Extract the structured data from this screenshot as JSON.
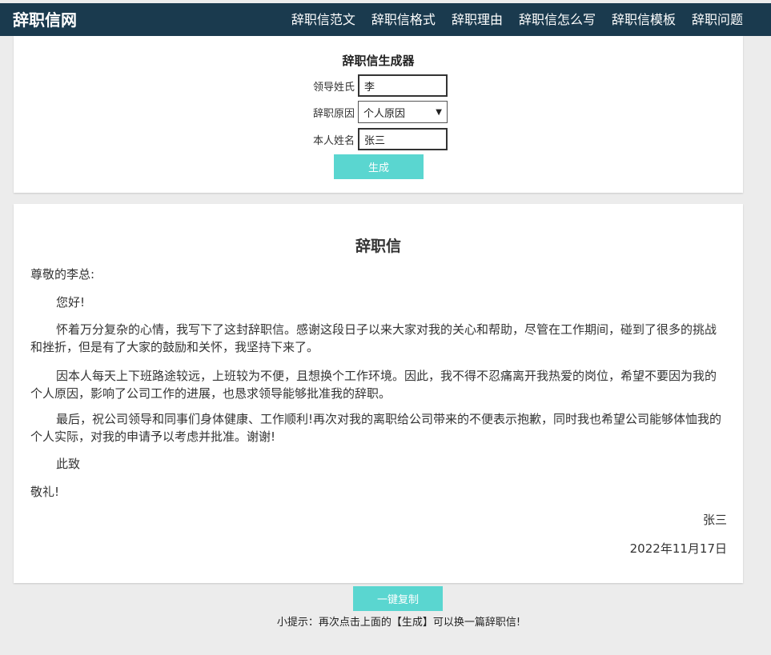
{
  "header": {
    "logo": "辞职信网",
    "nav": [
      "辞职信范文",
      "辞职信格式",
      "辞职理由",
      "辞职信怎么写",
      "辞职信模板",
      "辞职问题"
    ]
  },
  "generator": {
    "title": "辞职信生成器",
    "leader_label": "领导姓氏",
    "leader_value": "李",
    "reason_label": "辞职原因",
    "reason_value": "个人原因",
    "name_label": "本人姓名",
    "name_value": "张三",
    "generate_label": "生成"
  },
  "letter": {
    "title": "辞职信",
    "greeting": "尊敬的李总:",
    "hello": "您好!",
    "para1": "怀着万分复杂的心情，我写下了这封辞职信。感谢这段日子以来大家对我的关心和帮助，尽管在工作期间，碰到了很多的挑战和挫折，但是有了大家的鼓励和关怀，我坚持下来了。",
    "para2": "因本人每天上下班路途较远，上班较为不便，且想换个工作环境。因此，我不得不忍痛离开我热爱的岗位，希望不要因为我的个人原因，影响了公司工作的进展，也恳求领导能够批准我的辞职。",
    "para3": "最后，祝公司领导和同事们身体健康、工作顺利!再次对我的离职给公司带来的不便表示抱歉，同时我也希望公司能够体恤我的个人实际，对我的申请予以考虑并批准。谢谢!",
    "closing": "此致",
    "regards": "敬礼!",
    "signature": "张三",
    "date": "2022年11月17日"
  },
  "footer": {
    "copy_label": "一键复制",
    "tip": "小提示：再次点击上面的【生成】可以换一篇辞职信!"
  },
  "colors": {
    "header_bg": "#1a3a4e",
    "button": "#5ad6d0"
  }
}
